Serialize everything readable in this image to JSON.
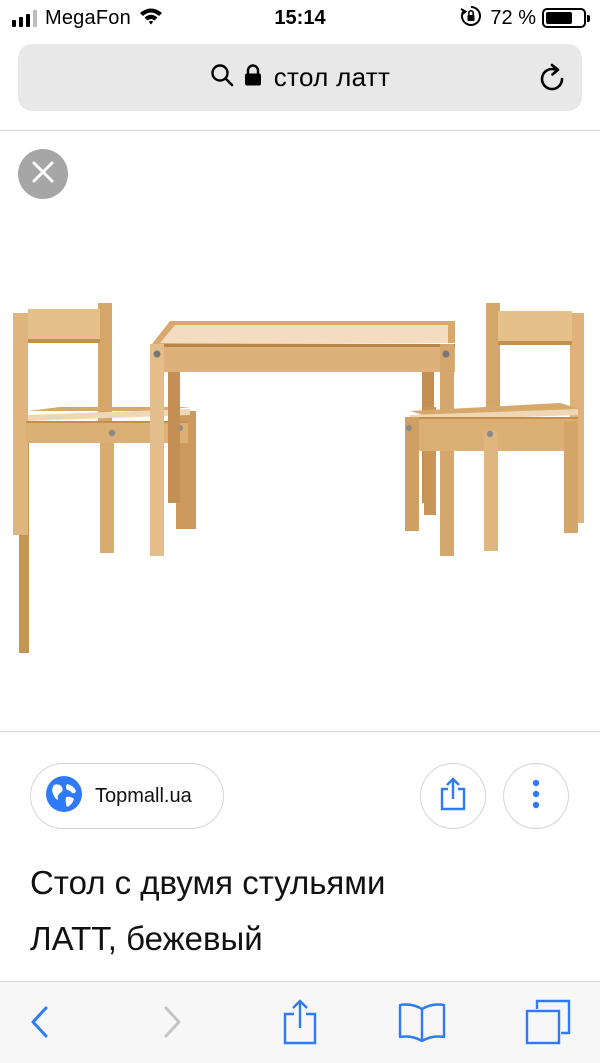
{
  "status_bar": {
    "carrier": "MegaFon",
    "time": "15:14",
    "battery_percent_label": "72 %",
    "battery_level": 0.72,
    "signal_bars": [
      1,
      1,
      1,
      0
    ],
    "icons": [
      "signal-icon",
      "wifi-icon",
      "orientation-lock-icon",
      "battery-icon"
    ]
  },
  "url_bar": {
    "text": "стол латт",
    "icons": [
      "search-icon",
      "lock-icon",
      "reload-icon"
    ]
  },
  "image_viewer": {
    "close_icon": "close-icon",
    "image_subject": "table-with-two-chairs"
  },
  "source": {
    "label": "Topmall.ua",
    "icon": "globe-icon"
  },
  "actions": {
    "share_icon": "share-icon",
    "more_icon": "more-vertical-icon"
  },
  "caption": {
    "line1": "Стол с двумя стульями",
    "line2": "ЛАТТ, бежевый"
  },
  "toolbar": {
    "items": [
      "back-icon",
      "forward-icon",
      "share-icon",
      "bookmarks-icon",
      "tabs-icon"
    ]
  },
  "colors": {
    "accent": "#2f7af8",
    "pill_background": "#e8e8e9",
    "toolbar_background": "#f7f7f8",
    "disabled": "#c4c4c8"
  }
}
